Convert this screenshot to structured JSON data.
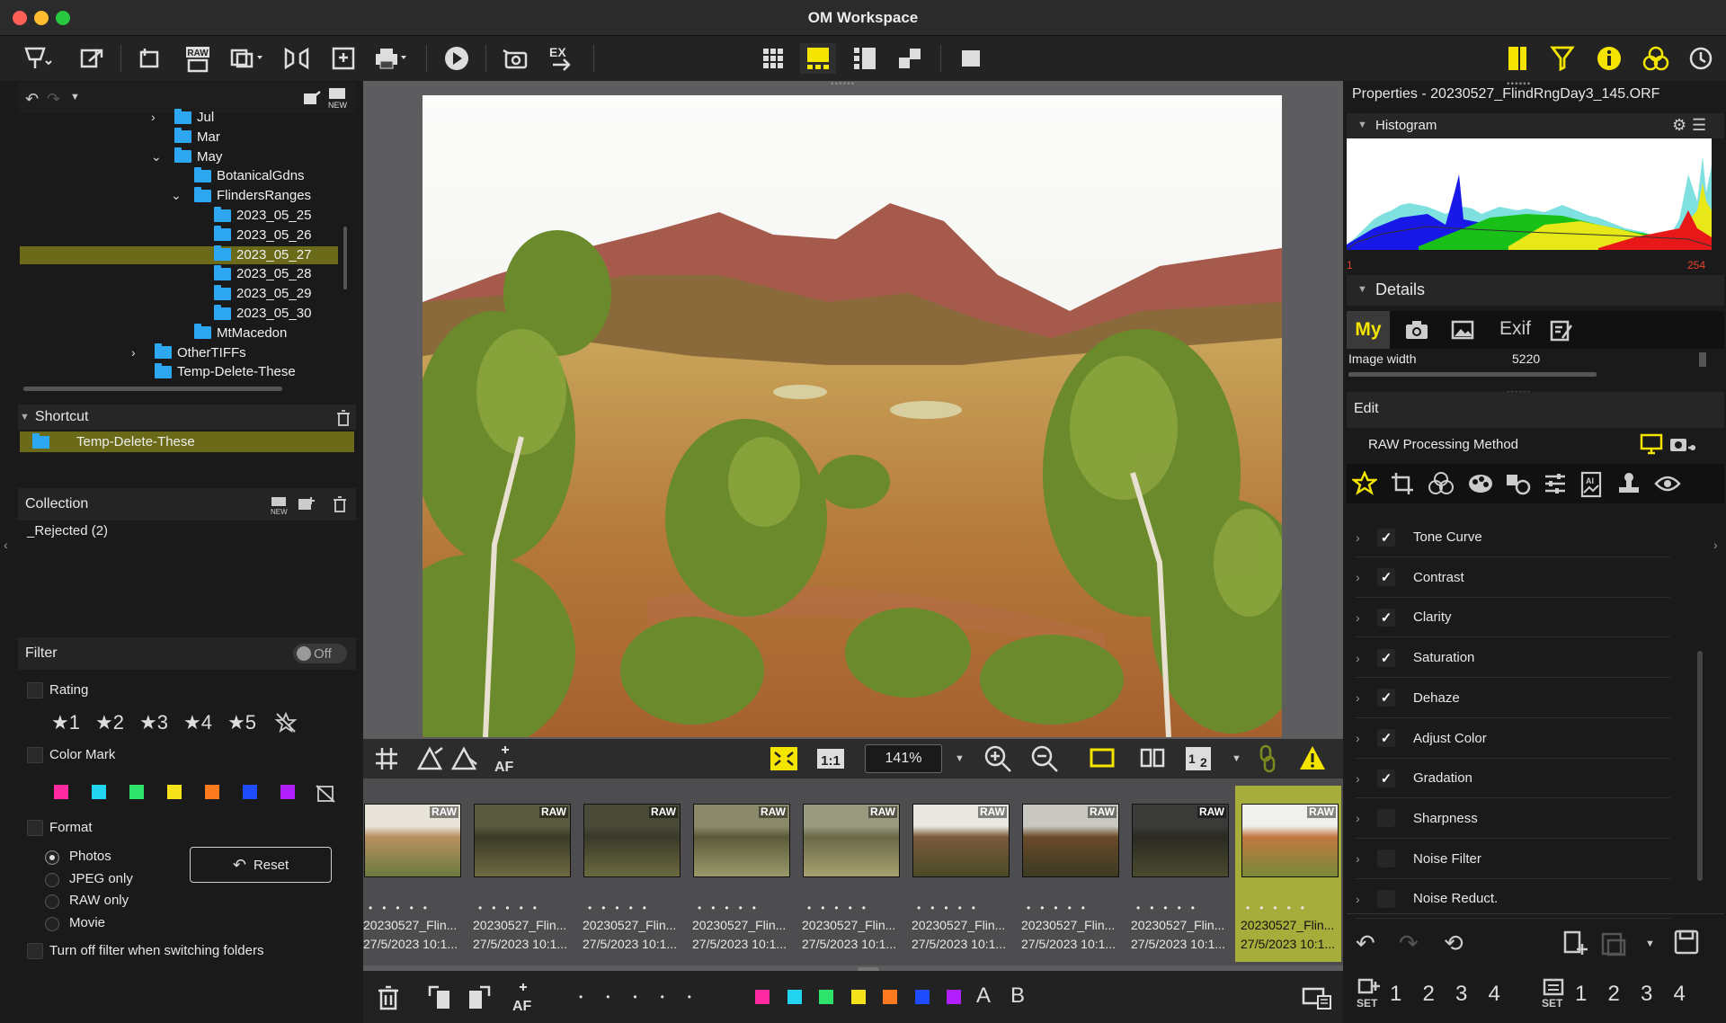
{
  "window": {
    "title": "OM Workspace"
  },
  "folder_tree": [
    {
      "label": "Jul",
      "expand": ">"
    },
    {
      "label": "Mar",
      "expand": ""
    },
    {
      "label": "May",
      "expand": "v"
    },
    {
      "label": "BotanicalGdns",
      "expand": ""
    },
    {
      "label": "FlindersRanges",
      "expand": "v"
    },
    {
      "label": "2023_05_25",
      "expand": ""
    },
    {
      "label": "2023_05_26",
      "expand": ""
    },
    {
      "label": "2023_05_27",
      "expand": "",
      "selected": true
    },
    {
      "label": "2023_05_28",
      "expand": ""
    },
    {
      "label": "2023_05_29",
      "expand": ""
    },
    {
      "label": "2023_05_30",
      "expand": ""
    },
    {
      "label": "MtMacedon",
      "expand": ""
    },
    {
      "label": "OtherTIFFs",
      "expand": ">"
    },
    {
      "label": "Temp-Delete-These",
      "expand": ""
    }
  ],
  "shortcut": {
    "header": "Shortcut",
    "item": "Temp-Delete-These"
  },
  "collection": {
    "header": "Collection",
    "item": "_Rejected (2)"
  },
  "filter": {
    "header": "Filter",
    "toggle": "Off",
    "rating_label": "Rating",
    "ratings": [
      "★1",
      "★2",
      "★3",
      "★4",
      "★5"
    ],
    "color_label": "Color Mark",
    "colors": [
      "#ff2aa0",
      "#22d4f0",
      "#2ee36b",
      "#f5e21a",
      "#ff7a1f",
      "#1f4cff",
      "#b11fff"
    ],
    "format_label": "Format",
    "formats": [
      "Photos",
      "JPEG only",
      "RAW only",
      "Movie"
    ],
    "selected_format": "Photos",
    "reset": "Reset",
    "turn_off": "Turn off filter when switching folders"
  },
  "viewer": {
    "zoom": "141%"
  },
  "thumbnails": [
    {
      "badge": "RAW",
      "name": "20230527_Flin...",
      "date": "27/5/2023 10:1..."
    },
    {
      "badge": "RAW",
      "name": "20230527_Flin...",
      "date": "27/5/2023 10:1..."
    },
    {
      "badge": "RAW",
      "name": "20230527_Flin...",
      "date": "27/5/2023 10:1..."
    },
    {
      "badge": "RAW",
      "name": "20230527_Flin...",
      "date": "27/5/2023 10:1..."
    },
    {
      "badge": "RAW",
      "name": "20230527_Flin...",
      "date": "27/5/2023 10:1..."
    },
    {
      "badge": "RAW",
      "name": "20230527_Flin...",
      "date": "27/5/2023 10:1..."
    },
    {
      "badge": "RAW",
      "name": "20230527_Flin...",
      "date": "27/5/2023 10:1..."
    },
    {
      "badge": "RAW",
      "name": "20230527_Flin...",
      "date": "27/5/2023 10:1..."
    },
    {
      "badge": "RAW",
      "name": "20230527_Flin...",
      "date": "27/5/2023 10:1...",
      "selected": true
    }
  ],
  "bottom": {
    "letter_a": "A",
    "letter_b": "B",
    "colors": [
      "#ff2aa0",
      "#22d4f0",
      "#2ee36b",
      "#f5e21a",
      "#ff7a1f",
      "#1f4cff",
      "#b11fff"
    ]
  },
  "properties": {
    "title": "Properties - 20230527_FlindRngDay3_145.ORF",
    "histogram_label": "Histogram",
    "hist_min": "1",
    "hist_max": "254",
    "details_label": "Details",
    "details_tabs": [
      "My",
      "Exif"
    ],
    "image_width_label": "Image width",
    "image_width_value": "5220",
    "edit_label": "Edit",
    "raw_method": "RAW Processing Method",
    "edit_items": [
      {
        "label": "Tone Curve",
        "checked": true
      },
      {
        "label": "Contrast",
        "checked": true
      },
      {
        "label": "Clarity",
        "checked": true
      },
      {
        "label": "Saturation",
        "checked": true
      },
      {
        "label": "Dehaze",
        "checked": true
      },
      {
        "label": "Adjust Color",
        "checked": true
      },
      {
        "label": "Gradation",
        "checked": true
      },
      {
        "label": "Sharpness",
        "checked": false
      },
      {
        "label": "Noise Filter",
        "checked": false
      },
      {
        "label": "Noise Reduct.",
        "checked": false
      }
    ],
    "set_numbers": [
      "1",
      "2",
      "3",
      "4"
    ]
  }
}
